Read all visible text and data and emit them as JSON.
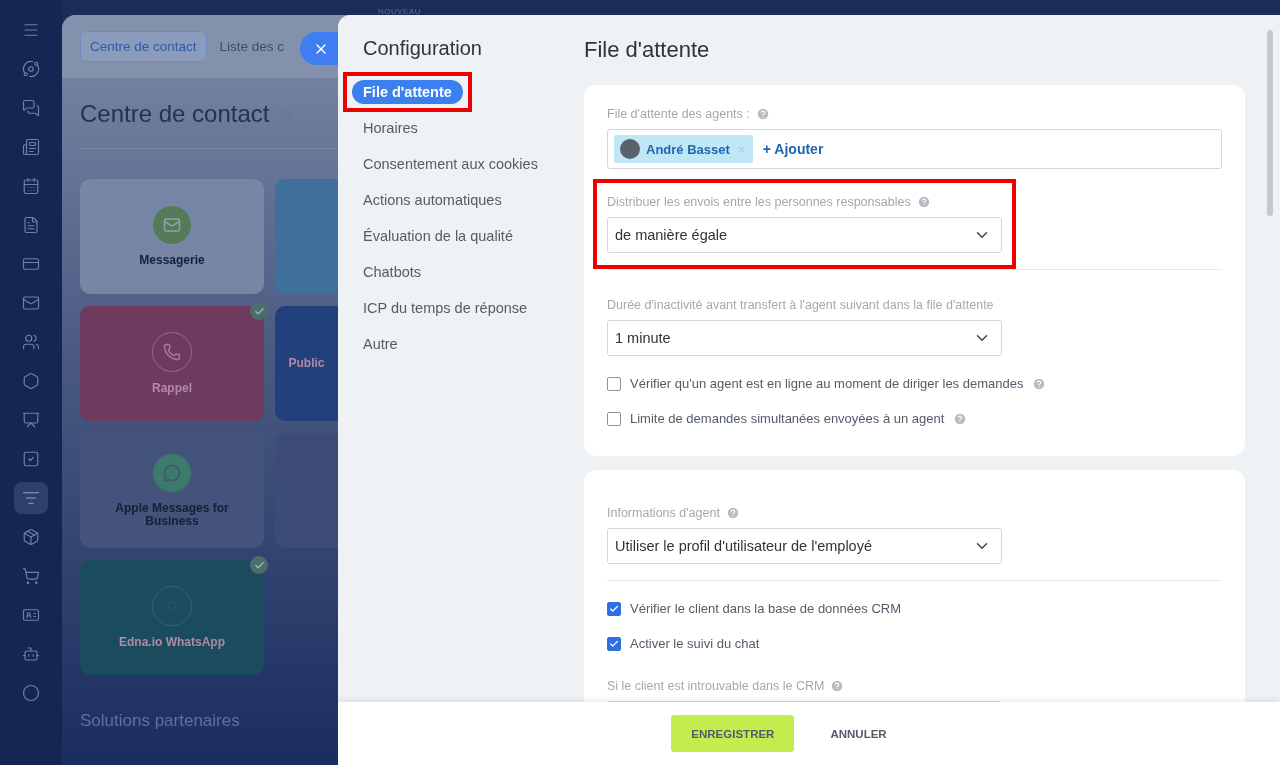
{
  "nav_icons": [
    {
      "kind": "menu",
      "selected": false
    },
    {
      "kind": "orbit",
      "selected": false
    },
    {
      "kind": "chat",
      "selected": false
    },
    {
      "kind": "news",
      "selected": false
    },
    {
      "kind": "calendar",
      "selected": false
    },
    {
      "kind": "file",
      "selected": false
    },
    {
      "kind": "card",
      "selected": false
    },
    {
      "kind": "mail",
      "selected": false
    },
    {
      "kind": "users",
      "selected": false
    },
    {
      "kind": "hexagon",
      "selected": false
    },
    {
      "kind": "board",
      "selected": false
    },
    {
      "kind": "task",
      "selected": false
    },
    {
      "kind": "funnel",
      "selected": true
    },
    {
      "kind": "box",
      "selected": false
    },
    {
      "kind": "cart",
      "selected": false
    },
    {
      "kind": "idcard",
      "selected": false
    },
    {
      "kind": "bot",
      "selected": false
    },
    {
      "kind": "circle",
      "selected": false
    }
  ],
  "badge": "NOUVEAU",
  "background_page": {
    "tabs": [
      {
        "label": "Centre de contact",
        "selected": true
      },
      {
        "label": "Liste des c",
        "selected": false
      }
    ],
    "title": "Centre de contact",
    "tiles": [
      {
        "label": "Messagerie",
        "kind": "mail",
        "color": "#7786a5",
        "connected": false
      },
      {
        "kind": "plain",
        "color": "#3f6f9b",
        "connected": false
      },
      {
        "label": "Rappel",
        "kind": "phone",
        "color": "#6e3a5e",
        "connected": true
      },
      {
        "label": "Public",
        "kind": "plain",
        "color": "#22407c",
        "connected": false
      },
      {
        "label": "Apple Messages for Business",
        "kind": "bubble",
        "color": "#43537c",
        "connected": false
      },
      {
        "kind": "plain",
        "color": "#3d4c76",
        "connected": false
      },
      {
        "label": "Edna.io WhatsApp",
        "kind": "edna",
        "color": "#1b4c5d",
        "connected": true
      }
    ],
    "section_heading": "Solutions partenaires"
  },
  "settings": {
    "title": "Configuration",
    "menu": [
      {
        "label": "File d'attente",
        "selected": true,
        "highlighted": true
      },
      {
        "label": "Horaires",
        "selected": false,
        "highlighted": false
      },
      {
        "label": "Consentement aux cookies",
        "selected": false,
        "highlighted": false
      },
      {
        "label": "Actions automatiques",
        "selected": false,
        "highlighted": false
      },
      {
        "label": "Évaluation de la qualité",
        "selected": false,
        "highlighted": false
      },
      {
        "label": "Chatbots",
        "selected": false,
        "highlighted": false
      },
      {
        "label": "ICP du temps de réponse",
        "selected": false,
        "highlighted": false
      },
      {
        "label": "Autre",
        "selected": false,
        "highlighted": false
      }
    ]
  },
  "page_title": "File d'attente",
  "cards": [
    {
      "rows": [
        {
          "kind": "tags",
          "label": "File d'attente des agents :",
          "help": true,
          "tags": [
            {
              "name": "André Basset"
            }
          ],
          "add_label": "+ Ajouter"
        },
        {
          "kind": "select",
          "label": "Distribuer les envois entre les personnes responsables",
          "help": true,
          "value": "de manière égale",
          "highlighted": true
        },
        {
          "kind": "divider"
        },
        {
          "kind": "select",
          "label": "Durée d'inactivité avant transfert à l'agent suivant dans la file d'attente",
          "help": false,
          "value": "1 minute",
          "highlighted": false
        },
        {
          "kind": "checkbox",
          "label": "Vérifier qu'un agent est en ligne au moment de diriger les demandes",
          "help": true,
          "checked": false
        },
        {
          "kind": "checkbox",
          "label": "Limite de demandes simultanées envoyées à un agent",
          "help": true,
          "checked": false
        }
      ]
    },
    {
      "rows": [
        {
          "kind": "select",
          "label": "Informations d'agent",
          "help": true,
          "value": "Utiliser le profil d'utilisateur de l'employé",
          "highlighted": false
        },
        {
          "kind": "divider"
        },
        {
          "kind": "checkbox",
          "label": "Vérifier le client dans la base de données CRM",
          "help": false,
          "checked": true
        },
        {
          "kind": "checkbox",
          "label": "Activer le suivi du chat",
          "help": false,
          "checked": true
        },
        {
          "kind": "select",
          "label": "Si le client est introuvable dans le CRM",
          "help": true,
          "highlighted": false
        }
      ]
    }
  ],
  "footer_buttons": [
    {
      "label": "ENREGISTRER",
      "kind": "primary"
    },
    {
      "label": "ANNULER",
      "kind": "link"
    }
  ]
}
